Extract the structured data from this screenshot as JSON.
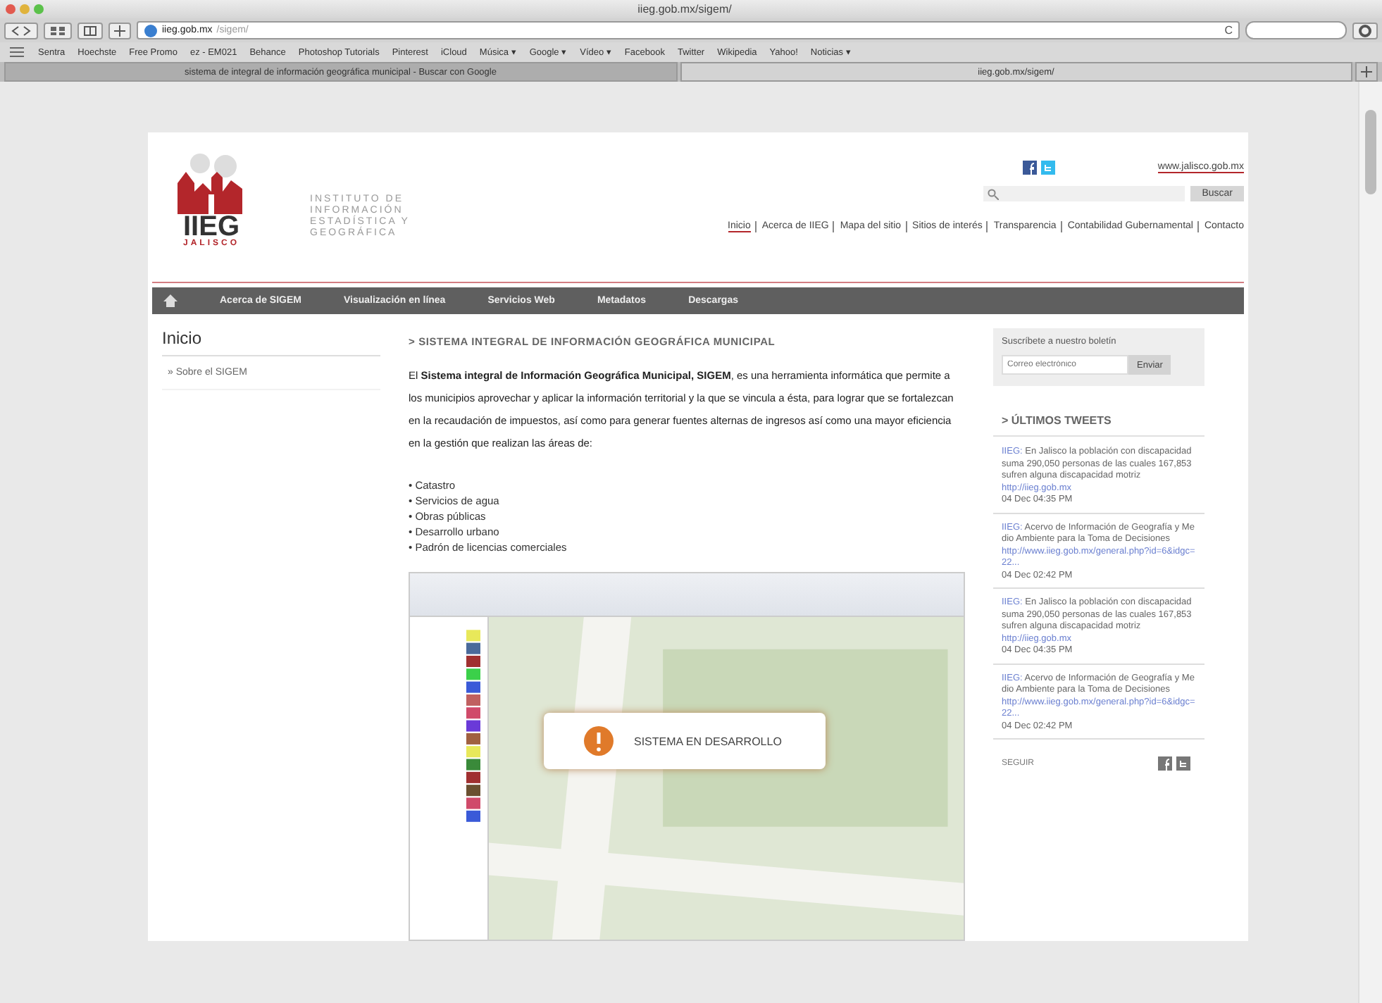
{
  "window": {
    "title": "iieg.gob.mx/sigem/"
  },
  "toolbar": {
    "url": "iieg.gob.mx",
    "url_rest": "/sigem/",
    "reload": "C"
  },
  "bookmarks": [
    "Sentra",
    "Hoechste",
    "Free Promo",
    "ez - EM021",
    "Behance",
    "Photoshop Tutorials",
    "Pinterest",
    "iCloud",
    "Música ▾",
    "Google ▾",
    "Vídeo ▾",
    "Facebook",
    "Twitter",
    "Wikipedia",
    "Yahoo!",
    "Noticias ▾"
  ],
  "tabs": [
    {
      "label": "sistema de integral de información geográfica municipal - Buscar con Google",
      "selected": false
    },
    {
      "label": "iieg.gob.mx/sigem/",
      "selected": true
    }
  ],
  "header": {
    "logo_text": "IIEG",
    "logo_sub": "JALISCO",
    "institute": "INSTITUTO DE INFORMACIÓN ESTADÍSTICA Y GEOGRÁFICA",
    "portal_link": "www.jalisco.gob.mx",
    "search_button": "Buscar",
    "links": [
      {
        "label": "Inicio",
        "selected": true
      },
      {
        "label": "Acerca de IIEG",
        "selected": false
      },
      {
        "label": "Mapa del sitio",
        "selected": false
      },
      {
        "label": "Sitios de interés",
        "selected": false
      },
      {
        "label": "Transparencia",
        "selected": false
      },
      {
        "label": "Contabilidad Gubernamental",
        "selected": false
      },
      {
        "label": "Contacto",
        "selected": false
      }
    ]
  },
  "menu": [
    "Acerca de SIGEM",
    "Visualización en línea",
    "Servicios Web",
    "Metadatos",
    "Descargas"
  ],
  "sidebar": {
    "title": "Inicio",
    "items": [
      "» Sobre el SIGEM"
    ]
  },
  "article": {
    "heading": "> SISTEMA INTEGRAL DE INFORMACIÓN GEOGRÁFICA MUNICIPAL",
    "paragraph": "El **Sistema integral de Información Geográfica Municipal, SIGEM**, es una herramienta informática que permite a los municipios aprovechar y aplicar la información territorial y la que se vincula a ésta, para lograr que se fortalezcan en la recaudación de impuestos, así como para generar fuentes alternas de ingresos así como una mayor eficiencia en la gestión que realizan las áreas de:",
    "areas": [
      "• Catastro",
      "• Servicios de agua",
      "• Obras públicas",
      "• Desarrollo urbano",
      "• Padrón de licencias comerciales"
    ],
    "notice": "SISTEMA EN DESARROLLO"
  },
  "newsletter": {
    "title": "Suscríbete a nuestro boletín",
    "placeholder": "Correo electrónico",
    "button": "Enviar"
  },
  "tweets_title": "> ÚLTIMOS TWEETS",
  "tweets": [
    {
      "handle": "IIEG:",
      "text": "En Jalisco la población con discapacidad suma 290,050 personas de las cuales 167,853 sufren alguna discapacidad motriz",
      "link": "http://iieg.gob.mx",
      "time": "04 Dec 04:35 PM"
    },
    {
      "handle": "IIEG:",
      "text": "Acervo de Información de Geografía y Medio Ambiente para la Toma de Decisiones",
      "link": "http://www.iieg.gob.mx/general.php?id=6&idgc=22...",
      "time": "04 Dec 02:42 PM"
    },
    {
      "handle": "IIEG:",
      "text": "En Jalisco la población con discapacidad suma 290,050 personas de las cuales 167,853 sufren alguna discapacidad motriz",
      "link": "http://iieg.gob.mx",
      "time": "04 Dec 04:35 PM"
    },
    {
      "handle": "IIEG:",
      "text": "Acervo de Información de Geografía y Medio Ambiente para la Toma de Decisiones",
      "link": "http://www.iieg.gob.mx/general.php?id=6&idgc=22...",
      "time": "04 Dec 02:42 PM"
    }
  ],
  "follow": "SEGUIR"
}
